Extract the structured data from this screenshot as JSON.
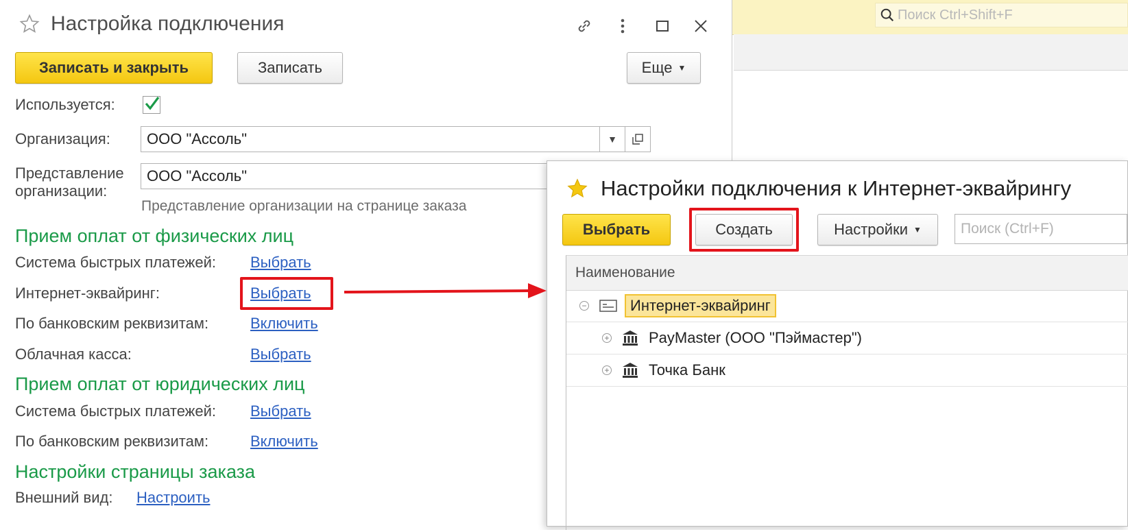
{
  "background": {
    "search_placeholder": "Поиск Ctrl+Shift+F"
  },
  "main_window": {
    "title": "Настройка подключения",
    "buttons": {
      "save_close": "Записать и закрыть",
      "save": "Записать",
      "more": "Еще"
    },
    "used_label": "Используется:",
    "used_checked": true,
    "org_label": "Организация:",
    "org_value": "ООО \"Ассоль\"",
    "org_repr_label": "Представление организации:",
    "org_repr_value": "ООО \"Ассоль\"",
    "org_repr_hint": "Представление организации на странице заказа",
    "section_individuals": {
      "title": "Прием оплат от физических лиц",
      "rows": [
        {
          "label": "Система быстрых платежей:",
          "link": "Выбрать"
        },
        {
          "label": "Интернет-эквайринг:",
          "link": "Выбрать"
        },
        {
          "label": "По банковским реквизитам:",
          "link": "Включить"
        },
        {
          "label": "Облачная касса:",
          "link": "Выбрать"
        }
      ]
    },
    "section_legal": {
      "title": "Прием оплат от юридических лиц",
      "rows": [
        {
          "label": "Система быстрых платежей:",
          "link": "Выбрать"
        },
        {
          "label": "По банковским реквизитам:",
          "link": "Включить"
        }
      ]
    },
    "section_order_page": {
      "title": "Настройки страницы заказа",
      "rows": [
        {
          "label": "Внешний вид:",
          "link": "Настроить"
        }
      ]
    }
  },
  "acquiring_window": {
    "title": "Настройки подключения к Интернет-эквайрингу",
    "buttons": {
      "select": "Выбрать",
      "create": "Создать",
      "settings": "Настройки"
    },
    "search_placeholder": "Поиск (Ctrl+F)",
    "column_header": "Наименование",
    "tree": [
      {
        "label": "Интернет-эквайринг",
        "icon": "card-icon",
        "expanded": true,
        "selected": true
      },
      {
        "label": "PayMaster (ООО \"Пэймастер\")",
        "icon": "bank-icon",
        "expanded": false
      },
      {
        "label": "Точка Банк",
        "icon": "bank-icon",
        "expanded": false
      }
    ]
  },
  "colors": {
    "accent_yellow": "#f4c711",
    "section_green": "#1a9a48",
    "link_blue": "#2b5fc1",
    "highlight_red": "#e3141b"
  }
}
